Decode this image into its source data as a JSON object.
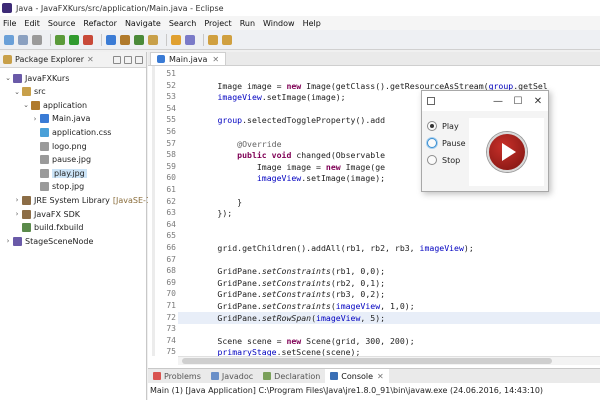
{
  "window": {
    "title": "Java - JavaFXKurs/src/application/Main.java - Eclipse"
  },
  "menu": [
    "File",
    "Edit",
    "Source",
    "Refactor",
    "Navigate",
    "Search",
    "Project",
    "Run",
    "Window",
    "Help"
  ],
  "explorer": {
    "title": "Package Explorer",
    "items": [
      {
        "label": "JavaFXKurs",
        "sub": "",
        "arrow": "⌄",
        "icon": "project-icon",
        "color": "#6a5aa8",
        "depth": 0,
        "selected": false
      },
      {
        "label": "src",
        "sub": "",
        "arrow": "⌄",
        "icon": "source-folder-icon",
        "color": "#c8a04a",
        "depth": 1,
        "selected": false
      },
      {
        "label": "application",
        "sub": "",
        "arrow": "⌄",
        "icon": "package-icon",
        "color": "#b07a2c",
        "depth": 2,
        "selected": false
      },
      {
        "label": "Main.java",
        "sub": "",
        "arrow": "›",
        "icon": "java-file-icon",
        "color": "#3a7bd5",
        "depth": 3,
        "selected": false
      },
      {
        "label": "application.css",
        "sub": "",
        "arrow": "",
        "icon": "css-file-icon",
        "color": "#4aa0d8",
        "depth": 3,
        "selected": false
      },
      {
        "label": "logo.png",
        "sub": "",
        "arrow": "",
        "icon": "image-file-icon",
        "color": "#9a9a9a",
        "depth": 3,
        "selected": false
      },
      {
        "label": "pause.jpg",
        "sub": "",
        "arrow": "",
        "icon": "image-file-icon",
        "color": "#9a9a9a",
        "depth": 3,
        "selected": false
      },
      {
        "label": "play.jpg",
        "sub": "",
        "arrow": "",
        "icon": "image-file-icon",
        "color": "#9a9a9a",
        "depth": 3,
        "selected": true
      },
      {
        "label": "stop.jpg",
        "sub": "",
        "arrow": "",
        "icon": "image-file-icon",
        "color": "#9a9a9a",
        "depth": 3,
        "selected": false
      },
      {
        "label": "JRE System Library",
        "sub": "[JavaSE-1.8]",
        "arrow": "›",
        "icon": "library-icon",
        "color": "#8c6d46",
        "depth": 1,
        "selected": false
      },
      {
        "label": "JavaFX SDK",
        "sub": "",
        "arrow": "›",
        "icon": "library-icon",
        "color": "#8c6d46",
        "depth": 1,
        "selected": false
      },
      {
        "label": "build.fxbuild",
        "sub": "",
        "arrow": "",
        "icon": "build-file-icon",
        "color": "#5a8a4a",
        "depth": 1,
        "selected": false
      },
      {
        "label": "StageSceneNode",
        "sub": "",
        "arrow": "›",
        "icon": "project-icon",
        "color": "#6a5aa8",
        "depth": 0,
        "selected": false
      }
    ]
  },
  "editor": {
    "tab_label": "Main.java",
    "highlight_line": "72",
    "lines": [
      {
        "no": "51",
        "text": ""
      },
      {
        "no": "52",
        "text": "        Image image = new Image(getClass().getResourceAsStream(group.getSel"
      },
      {
        "no": "53",
        "text": "        imageView.setImage(image);"
      },
      {
        "no": "54",
        "text": ""
      },
      {
        "no": "55",
        "text": "        group.selectedToggleProperty().add                      ener<Toggl"
      },
      {
        "no": "56",
        "text": ""
      },
      {
        "no": "57",
        "text": "            @Override"
      },
      {
        "no": "58",
        "text": "            public void changed(Observable                      observabl"
      },
      {
        "no": "59",
        "text": "                Image image = new Image(ge                      ream(grou"
      },
      {
        "no": "60",
        "text": "                imageView.setImage(image);"
      },
      {
        "no": "61",
        "text": ""
      },
      {
        "no": "62",
        "text": "            }"
      },
      {
        "no": "63",
        "text": "        });"
      },
      {
        "no": "64",
        "text": ""
      },
      {
        "no": "65",
        "text": ""
      },
      {
        "no": "66",
        "text": "        grid.getChildren().addAll(rb1, rb2, rb3, imageView);"
      },
      {
        "no": "67",
        "text": ""
      },
      {
        "no": "68",
        "text": "        GridPane.setConstraints(rb1, 0,0);"
      },
      {
        "no": "69",
        "text": "        GridPane.setConstraints(rb2, 0,1);"
      },
      {
        "no": "70",
        "text": "        GridPane.setConstraints(rb3, 0,2);"
      },
      {
        "no": "71",
        "text": "        GridPane.setConstraints(imageView, 1,0);"
      },
      {
        "no": "72",
        "text": "        GridPane.setRowSpan(imageView, 5);"
      },
      {
        "no": "73",
        "text": ""
      },
      {
        "no": "74",
        "text": "        Scene scene = new Scene(grid, 300, 200);"
      },
      {
        "no": "75",
        "text": "        primaryStage.setScene(scene);"
      }
    ]
  },
  "fx_window": {
    "radios": [
      {
        "label": "Play",
        "checked": true,
        "focused": false
      },
      {
        "label": "Pause",
        "checked": false,
        "focused": true
      },
      {
        "label": "Stop",
        "checked": false,
        "focused": false
      }
    ]
  },
  "bottom": {
    "tabs": [
      {
        "label": "Problems",
        "active": false,
        "icon": "problems-icon",
        "color": "#d9534f"
      },
      {
        "label": "Javadoc",
        "active": false,
        "icon": "javadoc-icon",
        "color": "#6a8fc8"
      },
      {
        "label": "Declaration",
        "active": false,
        "icon": "declaration-icon",
        "color": "#7aa05a"
      },
      {
        "label": "Console",
        "active": true,
        "icon": "console-icon",
        "color": "#3a6fb5"
      }
    ],
    "status": "Main (1) [Java Application] C:\\Program Files\\Java\\jre1.8.0_91\\bin\\javaw.exe (24.06.2016, 14:43:10)"
  },
  "toolbar_icons": [
    {
      "name": "new-icon",
      "color": "#6aa0d8"
    },
    {
      "name": "save-icon",
      "color": "#8aa0c0"
    },
    {
      "name": "print-icon",
      "color": "#9a9a9a"
    },
    {
      "name": "debug-icon",
      "color": "#5a9a3a"
    },
    {
      "name": "run-icon",
      "color": "#2f9a2f"
    },
    {
      "name": "external-tools-icon",
      "color": "#c84a3a"
    },
    {
      "name": "new-java-project-icon",
      "color": "#3a7bd5"
    },
    {
      "name": "new-package-icon",
      "color": "#b07a2c"
    },
    {
      "name": "new-class-icon",
      "color": "#4a8a3a"
    },
    {
      "name": "open-type-icon",
      "color": "#c8a04a"
    },
    {
      "name": "search-icon",
      "color": "#e0a030"
    },
    {
      "name": "annotation-icon",
      "color": "#7a7ac8"
    },
    {
      "name": "back-icon",
      "color": "#d0a040"
    },
    {
      "name": "forward-icon",
      "color": "#d0a040"
    }
  ]
}
